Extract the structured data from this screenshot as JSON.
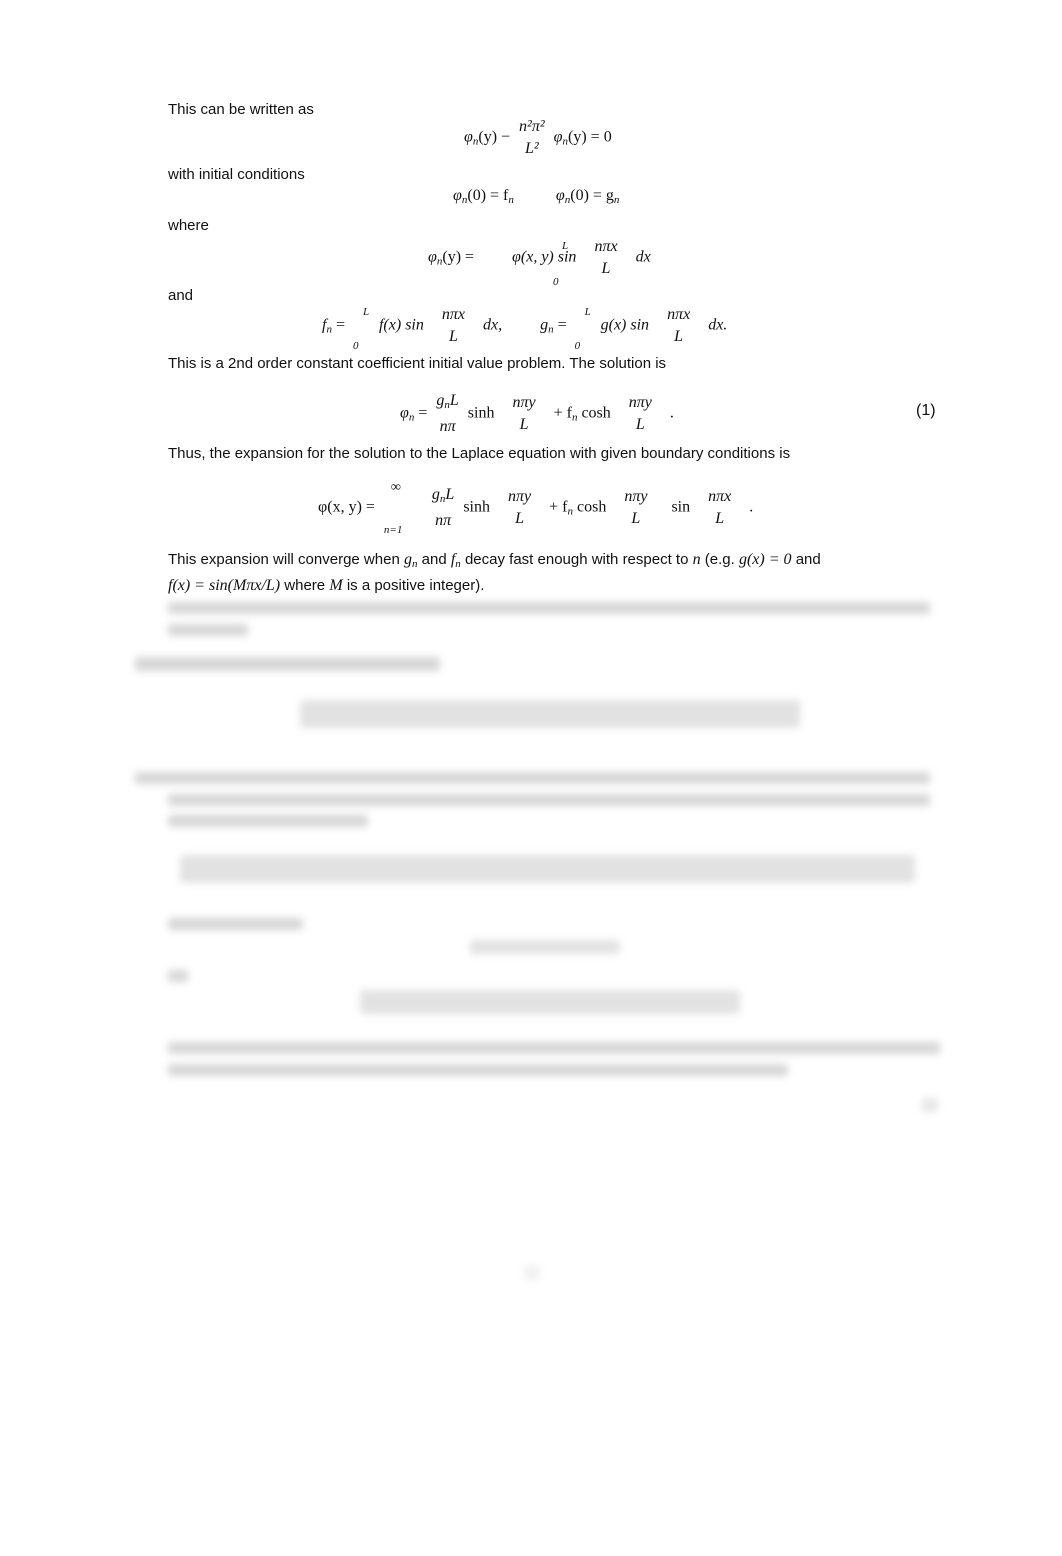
{
  "page": {
    "text_blocks": [
      "This can be written as",
      "with initial conditions",
      "where",
      "and",
      "This is a 2nd order constant coefficient initial value problem. The solution is",
      "Thus, the expansion for the solution to the Laplace equation with given boundary conditions is"
    ],
    "equations": {
      "ode": {
        "lhs": "φ",
        "lhs_sub": "n",
        "lhs_arg": "(y) −",
        "frac_num": "n²π²",
        "frac_den": "L²",
        "rhs_term": "φ",
        "rhs_sub": "n",
        "rhs_tail": "(y) = 0"
      },
      "initial_conditions": {
        "first": "φ",
        "first_sub": "n",
        "first_tail": "(0) = f",
        "first_tail_sub": "n",
        "second": "φ",
        "second_sub": "n",
        "second_tail": "(0) = g",
        "second_tail_sub": "n"
      },
      "phi_n_integral": {
        "lhs": "φ",
        "lhs_sub": "n",
        "lhs_tail": "(y) =",
        "upper": "L",
        "lower": "0",
        "integrand": "φ(x, y) sin",
        "frac_num": "nπx",
        "frac_den": "L",
        "differential": "dx"
      },
      "fn_gn": {
        "f_lhs": "f",
        "f_sub": "n",
        "f_eq": "=",
        "f_upper": "L",
        "f_lower": "0",
        "f_integrand": "f(x) sin",
        "f_num": "nπx",
        "f_den": "L",
        "f_diff": "dx,",
        "g_lhs": "g",
        "g_sub": "n",
        "g_eq": "=",
        "g_upper": "L",
        "g_lower": "0",
        "g_integrand": "g(x) sin",
        "g_num": "nπx",
        "g_den": "L",
        "g_diff": "dx."
      },
      "solution": {
        "lhs": "φ",
        "lhs_sub": "n",
        "eq": "=",
        "frac1_num": "g",
        "frac1_num_sub": "n",
        "frac1_num_tail": "L",
        "frac1_den": "nπ",
        "sinh": "sinh",
        "frac2_num": "nπy",
        "frac2_den": "L",
        "plus": "+ f",
        "plus_sub": "n",
        "cosh": "cosh",
        "frac3_num": "nπy",
        "frac3_den": "L",
        "end": ".",
        "label": "(1)"
      },
      "expansion": {
        "lhs": "φ(x, y) =",
        "sum_upper": "∞",
        "sum_lower": "n=1",
        "frac1_num": "g",
        "frac1_num_sub": "n",
        "frac1_num_tail": "L",
        "frac1_den": "nπ",
        "sinh": "sinh",
        "frac2_num": "nπy",
        "frac2_den": "L",
        "plus": "+ f",
        "plus_sub": "n",
        "cosh": "cosh",
        "frac3_num": "nπy",
        "frac3_den": "L",
        "sin": "sin",
        "frac4_num": "nπx",
        "frac4_den": "L",
        "end": "."
      }
    },
    "convergence": {
      "t1": "This expansion will converge when ",
      "m1": "g",
      "m1_sub": "n",
      "t2": " and ",
      "m2": "f",
      "m2_sub": "n",
      "t3": " decay fast enough with respect to ",
      "m3": "n",
      "t4": " (e.g.  ",
      "m4": "g(x) = 0",
      "t5": " and",
      "m5": "f(x) =  sin(Mπx/L)",
      "t6": " where ",
      "m6": "M",
      "t7": " is a positive integer)."
    }
  }
}
